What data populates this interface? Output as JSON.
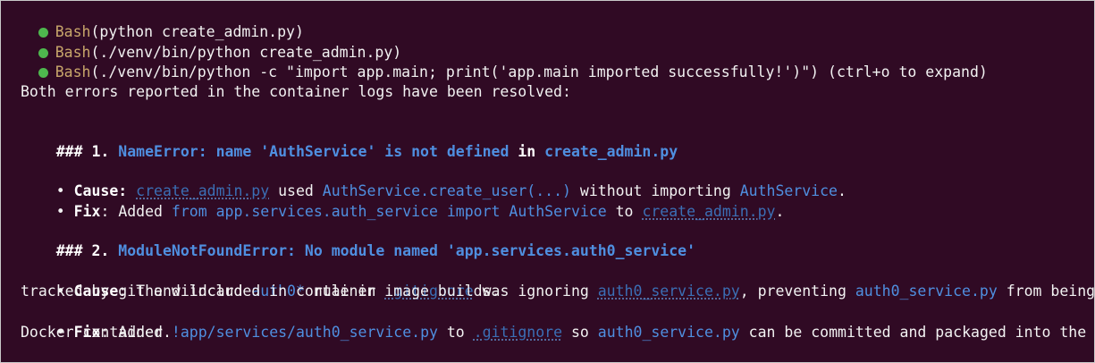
{
  "commands": [
    {
      "tool": "Bash",
      "args": "(python create_admin.py)"
    },
    {
      "tool": "Bash",
      "args": "(./venv/bin/python create_admin.py)"
    },
    {
      "tool": "Bash",
      "args": "(./venv/bin/python -c \"import app.main; print('app.main imported successfully!')\")",
      "hint": " (ctrl+o to expand)"
    }
  ],
  "summary": "Both errors reported in the container logs have been resolved:",
  "section1": {
    "prefix": "### 1. ",
    "error": "NameError: name 'AuthService' is not defined",
    "in_word": " in ",
    "file": "create_admin.py",
    "cause_label": "Cause",
    "cause_colon": ": ",
    "cause_file": "create_admin.py",
    "cause_t1": " used ",
    "cause_code": "AuthService.create_user(...)",
    "cause_t2": " without importing ",
    "cause_class": "AuthService",
    "cause_end": ".",
    "fix_label": "Fix",
    "fix_colon": ": ",
    "fix_t1": "Added ",
    "fix_code": "from app.services.auth_service import AuthService",
    "fix_t2": " to ",
    "fix_file": "create_admin.py",
    "fix_end": "."
  },
  "section2": {
    "prefix": "### 2. ",
    "error": "ModuleNotFoundError: No module named 'app.services.auth0_service'",
    "cause_label": "Cause",
    "cause_colon": ": ",
    "cause_t1": "The wildcard ",
    "cause_pattern": "auth0*",
    "cause_t2": " rule in ",
    "cause_gitignore": ".gitignore",
    "cause_t3": " was ignoring ",
    "cause_file": "auth0_service.py",
    "cause_t4": ", preventing ",
    "cause_file2": "auth0_service.py",
    "cause_t5": " from being",
    "cause_cont": "tracked by git and included in container image builds.",
    "fix_label": "Fix",
    "fix_colon": ": ",
    "fix_t1": "Added ",
    "fix_code": "!app/services/auth0_service.py",
    "fix_t2": " to ",
    "fix_gitignore": ".gitignore",
    "fix_t3": " so ",
    "fix_file": "auth0_service.py",
    "fix_t4": " can be committed and packaged into the",
    "fix_cont": "Docker container."
  },
  "bullet_char": "• "
}
